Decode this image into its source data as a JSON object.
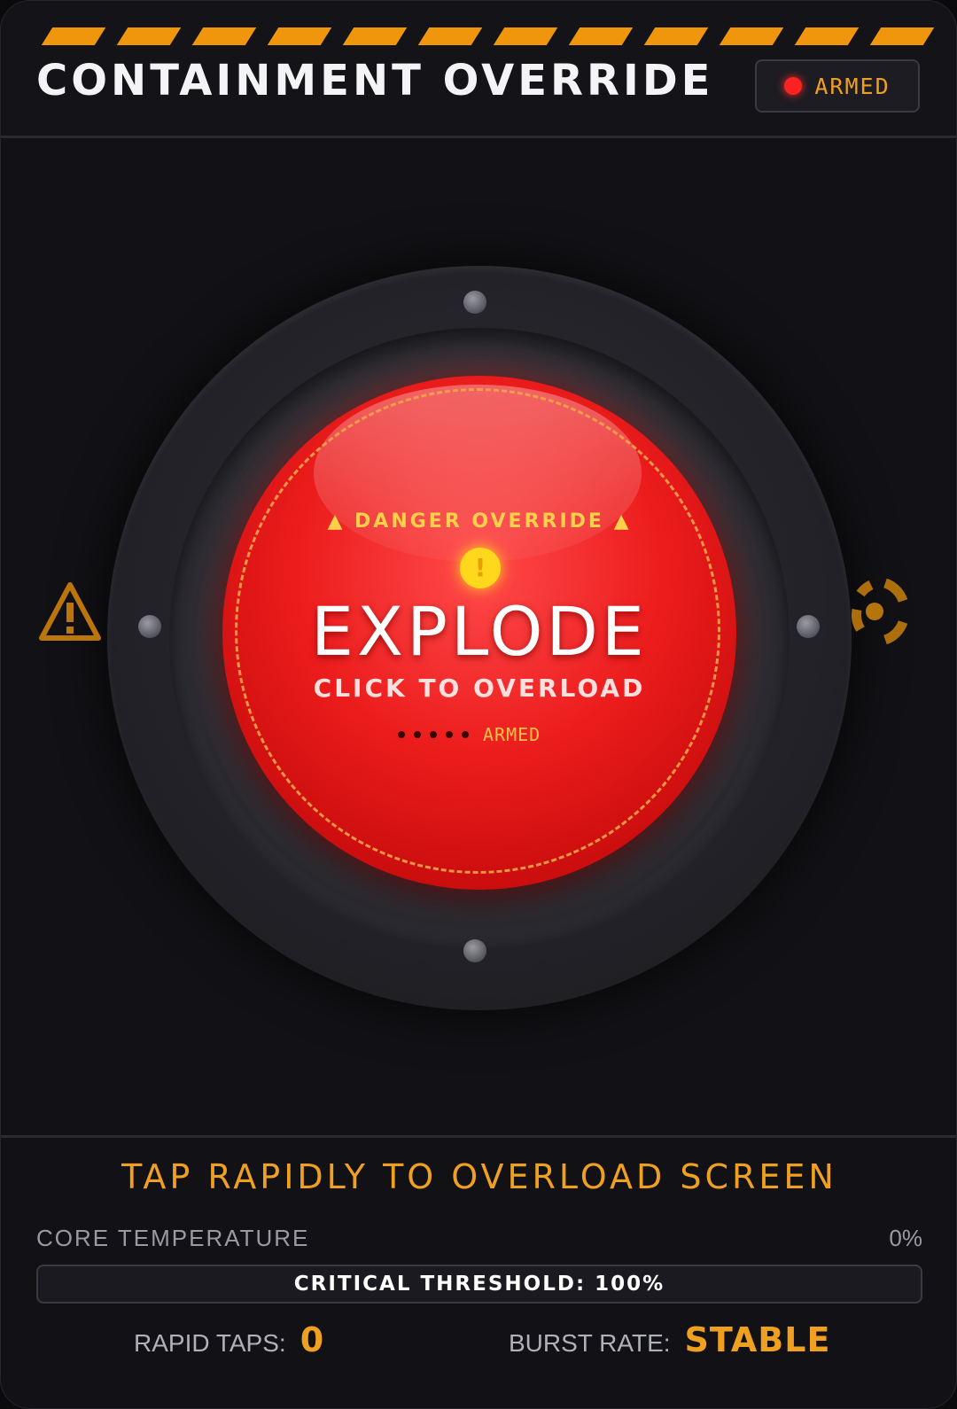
{
  "header": {
    "title": "CONTAINMENT OVERRIDE",
    "status_chip": {
      "label": "ARMED",
      "dot_color": "#ff2222"
    }
  },
  "button": {
    "danger_label": "▲ DANGER OVERRIDE ▲",
    "alert_glyph": "!",
    "main_label": "EXPLODE",
    "sub_label": "CLICK TO OVERLOAD",
    "status_label": "ARMED",
    "color": "#e81c1c"
  },
  "side_icons": {
    "left": "warning-triangle-icon",
    "right": "radiation-icon"
  },
  "footer": {
    "instruction": "TAP RAPIDLY TO OVERLOAD SCREEN",
    "temperature": {
      "label": "CORE TEMPERATURE",
      "value": "0%",
      "fill_fraction": 0,
      "threshold_text": "CRITICAL THRESHOLD: 100%"
    },
    "stats": {
      "taps_label": "RAPID TAPS:",
      "taps_value": "0",
      "burst_label": "BURST RATE:",
      "burst_value": "STABLE"
    }
  },
  "colors": {
    "accent": "#f0960d",
    "background": "#121216"
  }
}
